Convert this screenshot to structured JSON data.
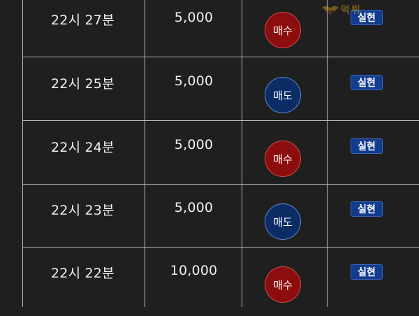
{
  "rows": [
    {
      "time": "22시 27분",
      "amount": "5,000",
      "side_label": "매수",
      "side_type": "buy",
      "status": "실현"
    },
    {
      "time": "22시 25분",
      "amount": "5,000",
      "side_label": "매도",
      "side_type": "sell",
      "status": "실현"
    },
    {
      "time": "22시 24분",
      "amount": "5,000",
      "side_label": "매수",
      "side_type": "buy",
      "status": "실현"
    },
    {
      "time": "22시 23분",
      "amount": "5,000",
      "side_label": "매도",
      "side_type": "sell",
      "status": "실현"
    },
    {
      "time": "22시 22분",
      "amount": "10,000",
      "side_label": "매수",
      "side_type": "buy",
      "status": "실현"
    }
  ],
  "watermark": {
    "text": "먹튀",
    "icon": "wings-logo-icon"
  },
  "colors": {
    "background": "#1f1f1f",
    "buy": "#8b0d0d",
    "sell": "#0c2c66",
    "status": "#123c8e"
  }
}
